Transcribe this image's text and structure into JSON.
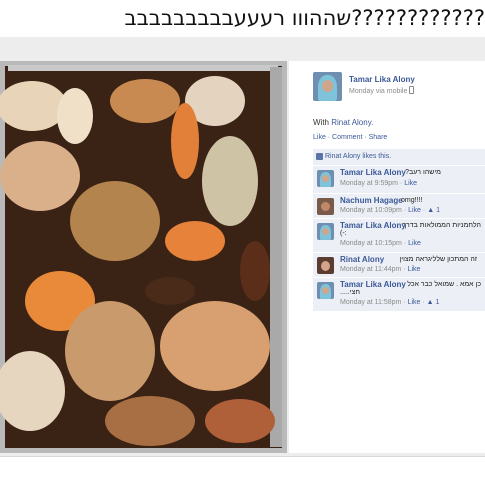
{
  "page_title": "שההווו רעעעבבבבבבבבב????????????",
  "post": {
    "author": "Tamar Lika Alony",
    "meta": "Monday via mobile",
    "with_prefix": "With",
    "with_name": "Rinat Alony.",
    "actions": "Like · Comment · Share",
    "likes_text": "Rinat Alony likes this."
  },
  "comments": [
    {
      "author": "Tamar Lika Alony",
      "text": "מישהו רעב?",
      "time": "Monday at 9:59pm",
      "like": "Like",
      "count": ""
    },
    {
      "author": "Nachum Hagage",
      "text": "omg!!!!",
      "time": "Monday at 10:09pm",
      "like": "Like",
      "count": "1"
    },
    {
      "author": "Tamar Lika Alony",
      "text": "הלחמניות הממולאות בדרך",
      "text2": "(-:",
      "time": "Monday at 10:15pm",
      "like": "Like",
      "count": ""
    },
    {
      "author": "Rinat Alony",
      "text": "זה המתכון שלליגראה מצוין",
      "time": "Monday at 11:44pm",
      "like": "Like",
      "count": ""
    },
    {
      "author": "Tamar Lika Alony",
      "text": "כן אמא . שמואל כבר אכל",
      "text2": "חצי.....",
      "time": "Monday at 11:58pm",
      "like": "Like",
      "count": "1"
    }
  ],
  "colors": {
    "link": "#3b5998",
    "comment_bg": "#eceff5",
    "band": "#ededed"
  },
  "icons": {
    "like": "thumbs-up-icon",
    "mobile": "mobile-icon"
  }
}
